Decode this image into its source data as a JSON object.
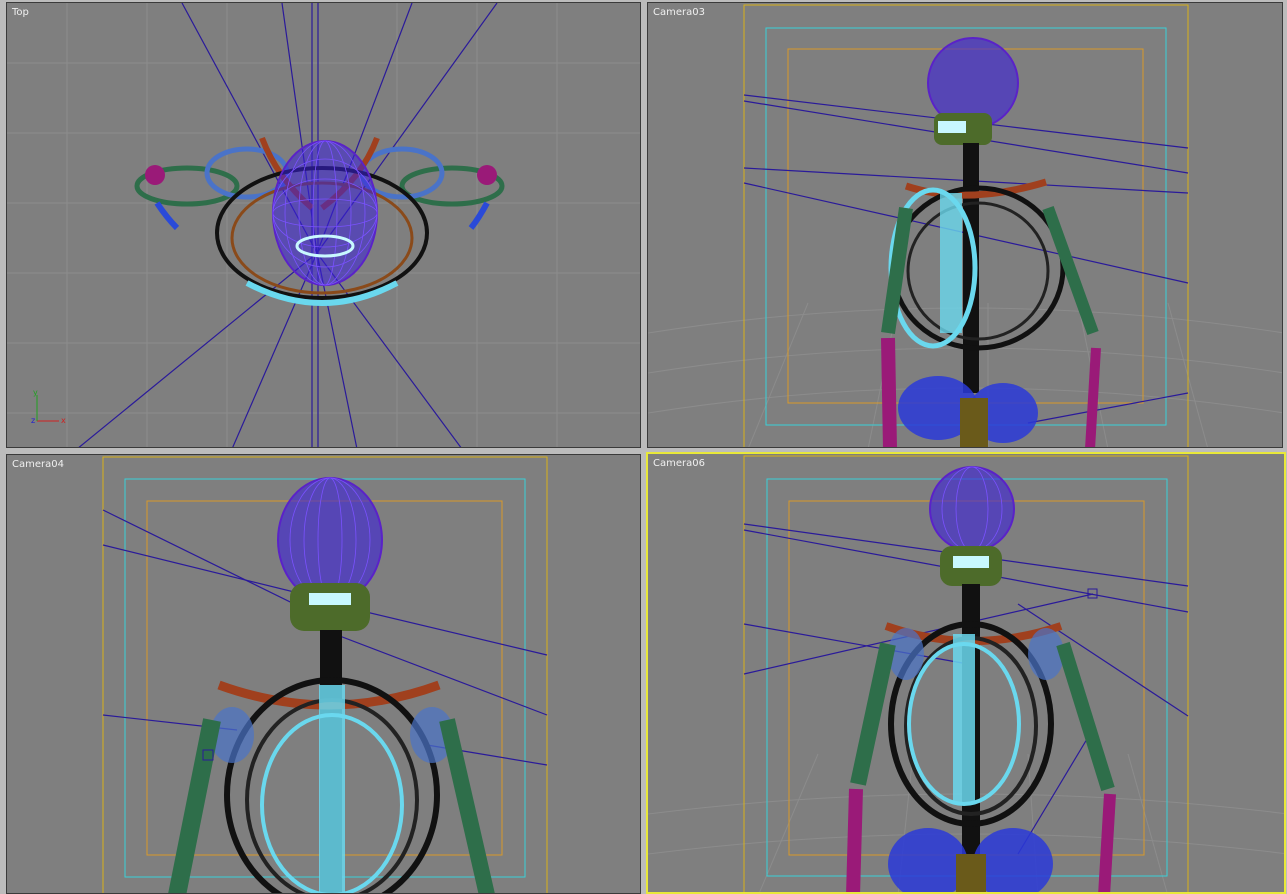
{
  "viewports": [
    {
      "label": "Top",
      "active": false
    },
    {
      "label": "Camera03",
      "active": false
    },
    {
      "label": "Camera04",
      "active": false
    },
    {
      "label": "Camera06",
      "active": true
    }
  ],
  "axis_gizmo": {
    "x": "x",
    "y": "y",
    "z": "z"
  },
  "colors": {
    "viewport_bg": "#7f7f7f",
    "grid": "#8c8c8c",
    "skull": "#5a22c8",
    "jaw": "#4d6b2a",
    "teeth": "#c8f8ff",
    "clavicle": "#a0401e",
    "scapula": "#4a73c8",
    "ribs": "#111111",
    "sternum": "#6ad8ee",
    "humerus": "#2e6e4a",
    "forearm": "#9a1a78",
    "pelvis": "#2a3ad8",
    "safe_outer": "#d8b21a",
    "safe_mid": "#38d0d8",
    "safe_inner": "#d89a2a",
    "lines": "#2a1a9a",
    "active_border": "#e8e83a"
  }
}
